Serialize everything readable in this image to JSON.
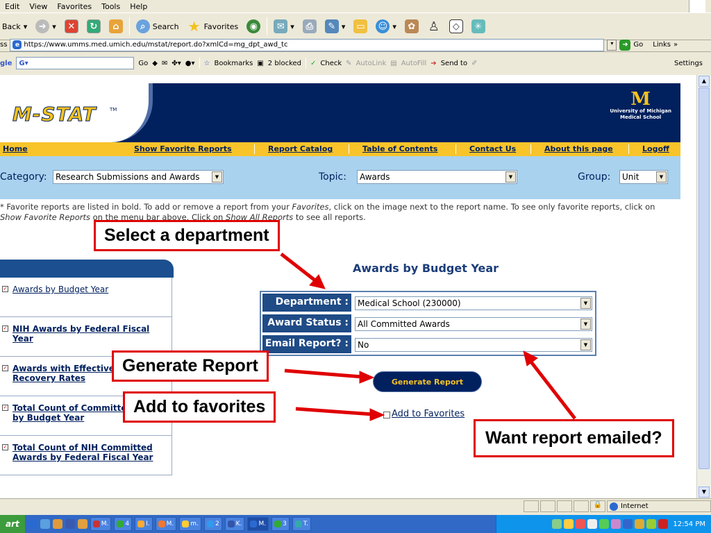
{
  "browser": {
    "menu": [
      "Edit",
      "View",
      "Favorites",
      "Tools",
      "Help"
    ],
    "toolbar": {
      "back": "Back",
      "search": "Search",
      "favorites": "Favorites"
    },
    "address": {
      "label": "ss",
      "url": "https://www.umms.med.umich.edu/mstat/report.do?xmlCd=mg_dpt_awd_tc",
      "go": "Go",
      "links": "Links"
    },
    "google": {
      "label": "gle",
      "go": "Go",
      "bookmarks": "Bookmarks",
      "blocked": "2 blocked",
      "check": "Check",
      "autolink": "AutoLink",
      "autofill": "AutoFill",
      "sendto": "Send to",
      "settings": "Settings"
    },
    "status": {
      "zone": "Internet"
    },
    "taskbar": {
      "start": "art",
      "items": [
        "M.",
        "4",
        "I.",
        "M.",
        "m.",
        "2",
        "K.",
        "M.",
        "3",
        "T."
      ],
      "clock": "12:54 PM"
    }
  },
  "site": {
    "logo": "M-STAT",
    "tm": "TM",
    "um_line1": "University of Michigan",
    "um_line2": "Medical School",
    "nav": {
      "home": "Home",
      "favorites": "Show Favorite Reports",
      "catalog": "Report Catalog",
      "toc": "Table of Contents",
      "contact": "Contact Us",
      "about": "About this page",
      "logoff": "Logoff"
    },
    "filters": {
      "category_label": "Category:",
      "category_value": "Research Submissions and Awards",
      "topic_label": "Topic:",
      "topic_value": "Awards",
      "group_label": "Group:",
      "group_value": "Unit"
    },
    "note": {
      "p1": "* Favorite reports are listed in bold. To add or remove a report from your ",
      "favorites_word": "Favorites",
      "p2": ", click on the image next to the report name. To see only favorite reports, click on",
      "p3": "Show Favorite Reports",
      "p4": " on the menu bar above. Click on ",
      "show_all": "Show All Reports",
      "p5": " to see all reports."
    },
    "sidebar": [
      {
        "line1": "Awards by Budget Year",
        "line2": "",
        "bold": false
      },
      {
        "line1": "NIH Awards by Federal Fiscal",
        "line2": "Year",
        "bold": true
      },
      {
        "line1": "Awards with Effective",
        "line2": "Recovery Rates",
        "bold": true
      },
      {
        "line1": "Total Count of Committe",
        "line2": "by Budget Year",
        "bold": true
      },
      {
        "line1": "Total Count of NIH Committed",
        "line2": "Awards by Federal Fiscal Year",
        "bold": true
      }
    ],
    "report": {
      "title": "Awards by Budget Year",
      "department_label": "Department :",
      "department_value": "Medical School (230000)",
      "status_label": "Award Status :",
      "status_value": "All Committed Awards",
      "email_label": "Email Report? :",
      "email_value": "No",
      "generate": "Generate Report",
      "add_fav": "Add to Favorites"
    }
  },
  "callouts": {
    "department": "Select a department",
    "generate": "Generate Report",
    "favorites": "Add to favorites",
    "email": "Want report emailed?"
  },
  "colors": {
    "navy": "#00205e",
    "maize": "#f8c42a",
    "filter_bg": "#a9d2ee",
    "callout_red": "#e00000"
  }
}
